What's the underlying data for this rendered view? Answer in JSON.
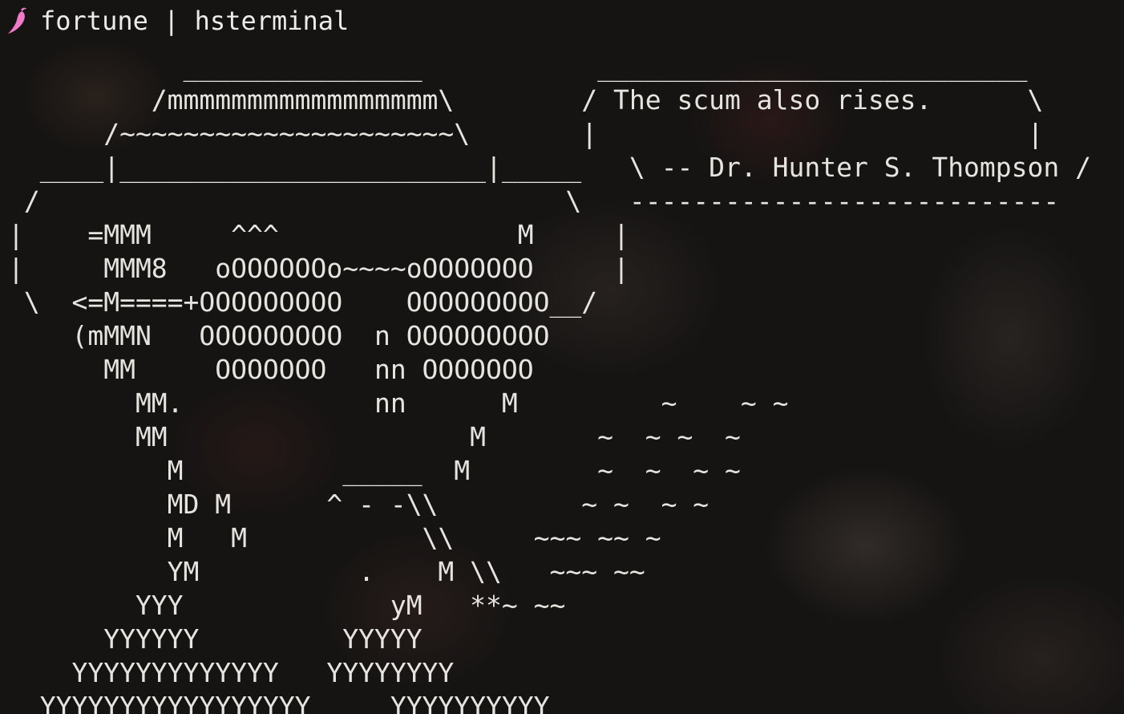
{
  "window": {
    "title": "fortune | hsterminal",
    "icon": "pepper-icon",
    "icon_color": "#f07ac8"
  },
  "output": {
    "lines": [
      "           _______________           ___________________________",
      "         /mmmmmmmmmmmmmmmmm\\        / The scum also rises.      \\",
      "      /~~~~~~~~~~~~~~~~~~~~~\\       |                           |",
      "  ____|_______________________|_____   \\ -- Dr. Hunter S. Thompson /",
      " /                                 \\   ---------------------------",
      "|    =MMM     ^^^               M     |",
      "|     MMM8   oOOOOOOo~~~~oOOOOOOO     |",
      " \\  <=M====+OOOOOOOOO    OOOOOOOOO__/",
      "    (mMMN   OOOOOOOOO  n OOOOOOOOO",
      "      MM     OOOOOOO   nn OOOOOOO",
      "        MM.            nn      M         ~    ~ ~",
      "        MM                   M       ~  ~ ~  ~",
      "          M          _____  M        ~  ~  ~ ~",
      "          MD M      ^ - -\\\\         ~ ~  ~ ~",
      "          M   M           \\\\     ~~~ ~~ ~",
      "          YM          .    M \\\\   ~~~ ~~",
      "        YYY             yM   **~ ~~",
      "      YYYYYY         YYYYY",
      "    YYYYYYYYYYYYY   YYYYYYYY",
      "  YYYYYYYYYYYYYYYYY     YYYYYYYYYY"
    ]
  }
}
